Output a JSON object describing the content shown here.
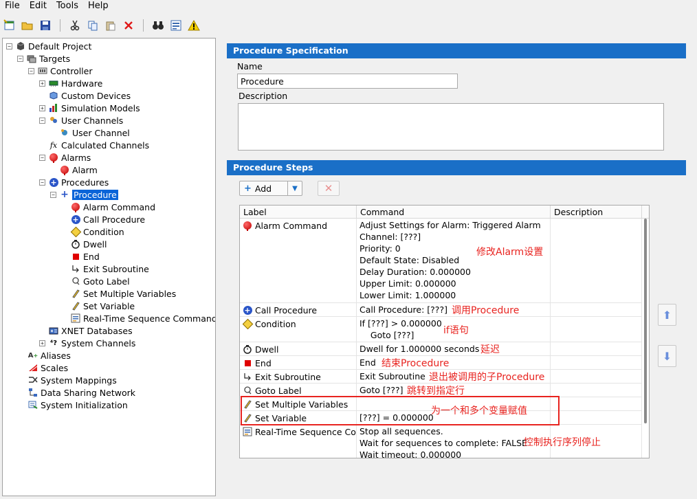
{
  "menu": [
    "File",
    "Edit",
    "Tools",
    "Help"
  ],
  "tree": {
    "project": "Default Project",
    "targets": "Targets",
    "controller": "Controller",
    "hardware": "Hardware",
    "custom_devices": "Custom Devices",
    "simulation_models": "Simulation Models",
    "user_channels": "User Channels",
    "user_channel": "User Channel",
    "calculated_channels": "Calculated Channels",
    "alarms": "Alarms",
    "alarm": "Alarm",
    "procedures": "Procedures",
    "procedure": "Procedure",
    "steps": [
      "Alarm Command",
      "Call Procedure",
      "Condition",
      "Dwell",
      "End",
      "Exit Subroutine",
      "Goto Label",
      "Set Multiple Variables",
      "Set Variable",
      "Real-Time Sequence Command"
    ],
    "xnet": "XNET Databases",
    "system_channels": "System Channels",
    "aliases": "Aliases",
    "scales": "Scales",
    "system_mappings": "System Mappings",
    "data_sharing": "Data Sharing Network",
    "system_init": "System Initialization"
  },
  "spec": {
    "title": "Procedure Specification",
    "name_label": "Name",
    "name_value": "Procedure",
    "desc_label": "Description",
    "desc_value": ""
  },
  "steps": {
    "title": "Procedure Steps",
    "add_label": "Add",
    "columns": [
      "Label",
      "Command",
      "Description"
    ],
    "rows": [
      {
        "label": "Alarm Command",
        "command": [
          "Adjust Settings for Alarm: Triggered Alarm",
          "Channel: [???]",
          "Priority: 0",
          "Default State: Disabled",
          "Delay Duration: 0.000000",
          "Upper Limit: 0.000000",
          "Lower Limit: 1.000000"
        ]
      },
      {
        "label": "Call Procedure",
        "command": [
          "Call Procedure: [???]"
        ]
      },
      {
        "label": "Condition",
        "command": [
          "If [???] > 0.000000",
          "    Goto [???]"
        ]
      },
      {
        "label": "Dwell",
        "command": [
          "Dwell for 1.000000 seconds"
        ]
      },
      {
        "label": "End",
        "command": [
          "End"
        ]
      },
      {
        "label": "Exit Subroutine",
        "command": [
          "Exit Subroutine"
        ]
      },
      {
        "label": "Goto Label",
        "command": [
          "Goto [???]"
        ]
      },
      {
        "label": "Set Multiple Variables",
        "command": [
          ""
        ]
      },
      {
        "label": "Set Variable",
        "command": [
          "[???] = 0.000000"
        ]
      },
      {
        "label": "Real-Time Sequence Con",
        "command": [
          "Stop all sequences.",
          "Wait for sequences to complete: FALSE",
          "Wait timeout: 0.000000"
        ]
      }
    ]
  },
  "annotations": {
    "alarm": "修改Alarm设置",
    "call": "调用Procedure",
    "cond": "if语句",
    "dwell": "延迟",
    "end": "结束Procedure",
    "exit": "退出被调用的子Procedure",
    "goto": "跳转到指定行",
    "setvar": "为一个和多个变量赋值",
    "rts": "控制执行序列停止"
  }
}
